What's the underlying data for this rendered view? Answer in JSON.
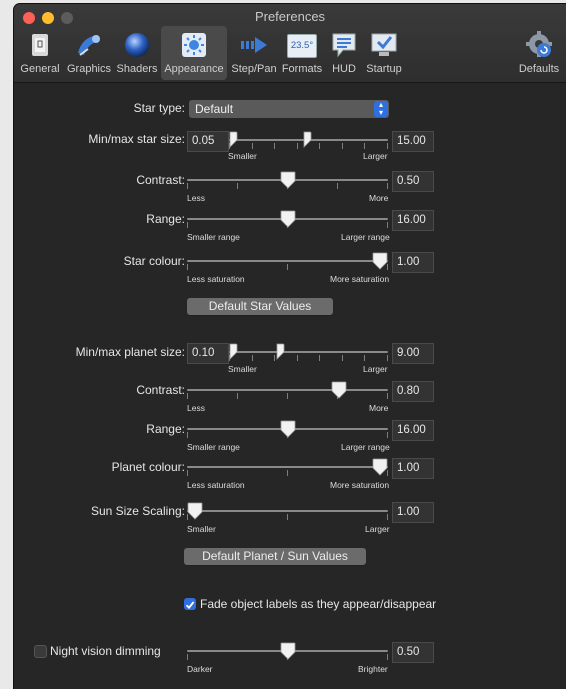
{
  "window": {
    "title": "Preferences"
  },
  "toolbar": {
    "items": [
      {
        "label": "General",
        "icon": "general-icon"
      },
      {
        "label": "Graphics",
        "icon": "graphics-icon"
      },
      {
        "label": "Shaders",
        "icon": "shaders-icon"
      },
      {
        "label": "Appearance",
        "icon": "appearance-icon",
        "selected": true
      },
      {
        "label": "Step/Pan",
        "icon": "step-pan-icon"
      },
      {
        "label": "Formats",
        "icon": "formats-icon",
        "icon_text": "23.5°"
      },
      {
        "label": "HUD",
        "icon": "hud-icon"
      },
      {
        "label": "Startup",
        "icon": "startup-icon"
      },
      {
        "label": "Defaults",
        "icon": "defaults-icon"
      }
    ]
  },
  "stars": {
    "star_type_label": "Star type:",
    "star_type_value": "Default",
    "size": {
      "label": "Min/max star size:",
      "min_value": "0.05",
      "max_value": "15.00",
      "cap_left": "Smaller",
      "cap_right": "Larger",
      "min_pos": 0.0,
      "max_pos": 0.5
    },
    "contrast": {
      "label": "Contrast:",
      "value": "0.50",
      "cap_left": "Less",
      "cap_right": "More",
      "pos": 0.5
    },
    "range": {
      "label": "Range:",
      "value": "16.00",
      "cap_left": "Smaller range",
      "cap_right": "Larger range",
      "pos": 0.5
    },
    "colour": {
      "label": "Star colour:",
      "value": "1.00",
      "cap_left": "Less saturation",
      "cap_right": "More saturation",
      "pos": 1.0
    },
    "default_button": "Default Star Values"
  },
  "planets": {
    "size": {
      "label": "Min/max planet size:",
      "min_value": "0.10",
      "max_value": "9.00",
      "cap_left": "Smaller",
      "cap_right": "Larger",
      "min_pos": 0.0,
      "max_pos": 0.32
    },
    "contrast": {
      "label": "Contrast:",
      "value": "0.80",
      "cap_left": "Less",
      "cap_right": "More",
      "pos": 0.78
    },
    "range": {
      "label": "Range:",
      "value": "16.00",
      "cap_left": "Smaller range",
      "cap_right": "Larger range",
      "pos": 0.5
    },
    "colour": {
      "label": "Planet colour:",
      "value": "1.00",
      "cap_left": "Less saturation",
      "cap_right": "More saturation",
      "pos": 1.0
    },
    "sun": {
      "label": "Sun Size Scaling:",
      "value": "1.00",
      "cap_left": "Smaller",
      "cap_right": "Larger",
      "pos": 0.0
    },
    "default_button": "Default Planet / Sun Values"
  },
  "fade": {
    "label": "Fade object labels as they appear/disappear",
    "checked": true
  },
  "night": {
    "label": "Night vision dimming",
    "checked": false,
    "value": "0.50",
    "cap_left": "Darker",
    "cap_right": "Brighter",
    "pos": 0.5
  },
  "colors": {
    "accent": "#2f6fe0",
    "background": "#262626"
  }
}
